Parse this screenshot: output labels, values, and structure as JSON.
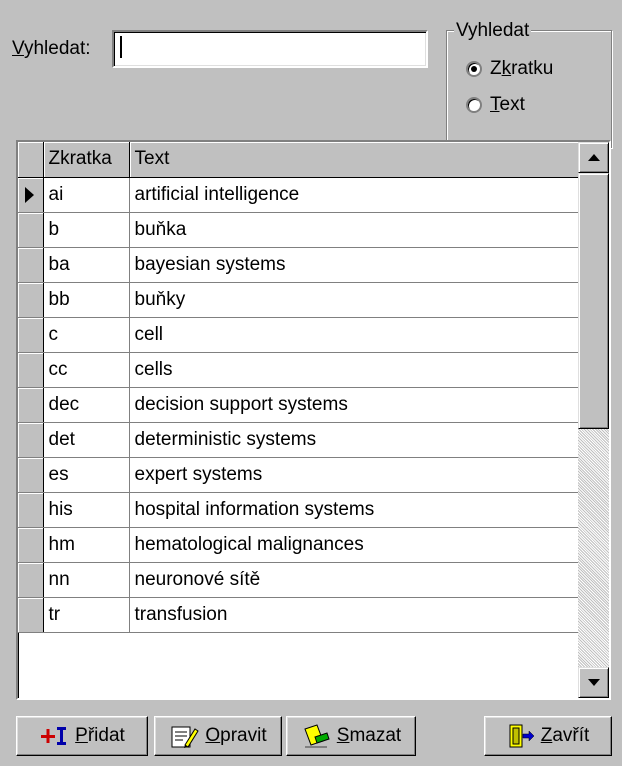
{
  "search": {
    "label_prefix": "",
    "label_underlined": "V",
    "label_rest": "yhledat:",
    "value": ""
  },
  "mode_group": {
    "title": "Vyhledat",
    "options": [
      {
        "underlined": "",
        "pre": "Z",
        "u": "k",
        "post": "ratku",
        "selected": true
      },
      {
        "pre": "",
        "u": "T",
        "post": "ext",
        "selected": false
      }
    ]
  },
  "table": {
    "columns": [
      "Zkratka",
      "Text"
    ],
    "rows": [
      {
        "abbr": "ai",
        "text": "artificial intelligence",
        "current": true
      },
      {
        "abbr": "b",
        "text": "buňka"
      },
      {
        "abbr": "ba",
        "text": "bayesian systems"
      },
      {
        "abbr": "bb",
        "text": "buňky"
      },
      {
        "abbr": "c",
        "text": "cell"
      },
      {
        "abbr": "cc",
        "text": "cells"
      },
      {
        "abbr": "dec",
        "text": "decision support systems"
      },
      {
        "abbr": "det",
        "text": "deterministic systems"
      },
      {
        "abbr": "es",
        "text": "expert systems"
      },
      {
        "abbr": "his",
        "text": "hospital information systems"
      },
      {
        "abbr": "hm",
        "text": "hematological malignances"
      },
      {
        "abbr": "nn",
        "text": "neuronové sítě"
      },
      {
        "abbr": "tr",
        "text": "transfusion"
      }
    ]
  },
  "buttons": {
    "add": {
      "u": "P",
      "rest": "řidat",
      "icon": "add-icon"
    },
    "edit": {
      "u": "O",
      "rest": "pravit",
      "icon": "edit-icon"
    },
    "delete": {
      "u": "S",
      "rest": "mazat",
      "icon": "delete-icon"
    },
    "close": {
      "u": "Z",
      "rest": "avřít",
      "icon": "exit-door-icon"
    }
  },
  "colors": {
    "window": "#c0c0c0",
    "grid_bg": "#ffffff"
  }
}
